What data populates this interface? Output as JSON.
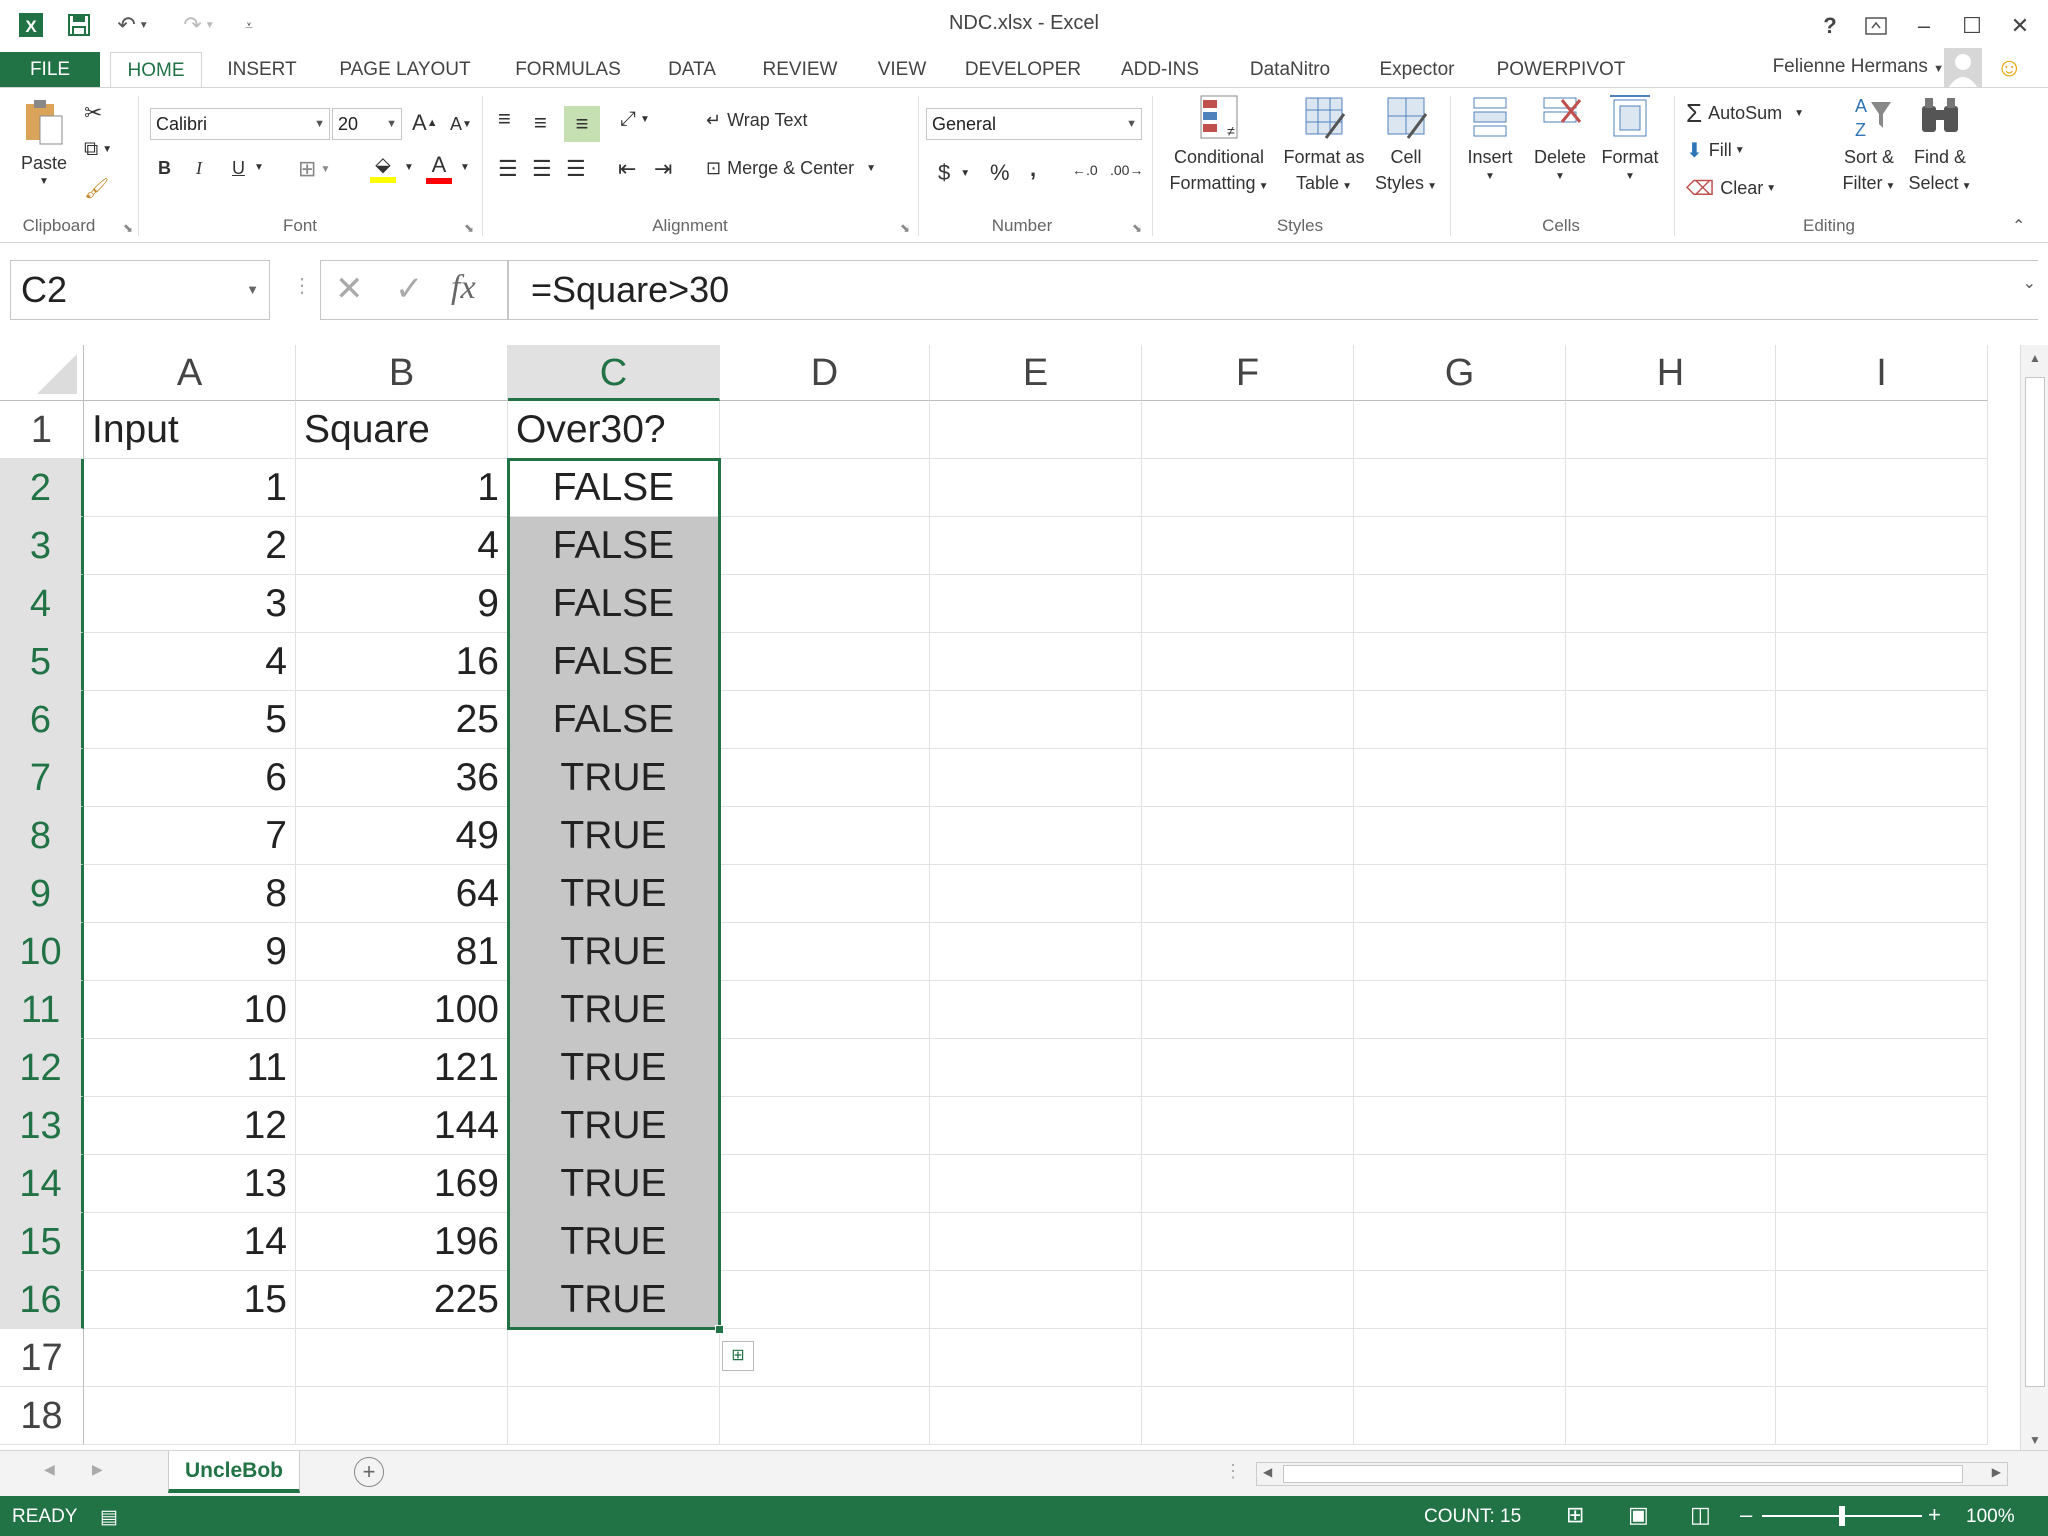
{
  "window": {
    "title": "NDC.xlsx - Excel",
    "help": "?",
    "user": "Felienne Hermans"
  },
  "ribbon_tabs": [
    "FILE",
    "HOME",
    "INSERT",
    "PAGE LAYOUT",
    "FORMULAS",
    "DATA",
    "REVIEW",
    "VIEW",
    "DEVELOPER",
    "ADD-INS",
    "DataNitro",
    "Expector",
    "POWERPIVOT"
  ],
  "ribbon": {
    "clipboard": {
      "paste": "Paste",
      "label": "Clipboard"
    },
    "font": {
      "name": "Calibri",
      "size": "20",
      "bold": "B",
      "italic": "I",
      "underline": "U",
      "label": "Font"
    },
    "alignment": {
      "wrap_text": "Wrap Text",
      "merge_center": "Merge & Center",
      "label": "Alignment"
    },
    "number": {
      "format": "General",
      "currency": "$",
      "percent": "%",
      "comma": ",",
      "label": "Number"
    },
    "styles": {
      "conditional_1": "Conditional",
      "conditional_2": "Formatting",
      "format_table_1": "Format as",
      "format_table_2": "Table",
      "cell_styles_1": "Cell",
      "cell_styles_2": "Styles",
      "label": "Styles"
    },
    "cells": {
      "insert": "Insert",
      "delete": "Delete",
      "format": "Format",
      "label": "Cells"
    },
    "editing": {
      "autosum": "AutoSum",
      "fill": "Fill",
      "clear": "Clear",
      "sort_1": "Sort &",
      "sort_2": "Filter",
      "find_1": "Find &",
      "find_2": "Select",
      "label": "Editing"
    }
  },
  "formula_bar": {
    "name_box": "C2",
    "fx": "fx",
    "formula": "=Square>30"
  },
  "sheet": {
    "columns": [
      "A",
      "B",
      "C",
      "D",
      "E",
      "F",
      "G",
      "H",
      "I"
    ],
    "selected_column": "C",
    "selected_rows": [
      2,
      16
    ],
    "rows": [
      {
        "n": "1",
        "a": "Input",
        "b": "Square",
        "c": "Over30?"
      },
      {
        "n": "2",
        "a": "1",
        "b": "1",
        "c": "FALSE"
      },
      {
        "n": "3",
        "a": "2",
        "b": "4",
        "c": "FALSE"
      },
      {
        "n": "4",
        "a": "3",
        "b": "9",
        "c": "FALSE"
      },
      {
        "n": "5",
        "a": "4",
        "b": "16",
        "c": "FALSE"
      },
      {
        "n": "6",
        "a": "5",
        "b": "25",
        "c": "FALSE"
      },
      {
        "n": "7",
        "a": "6",
        "b": "36",
        "c": "TRUE"
      },
      {
        "n": "8",
        "a": "7",
        "b": "49",
        "c": "TRUE"
      },
      {
        "n": "9",
        "a": "8",
        "b": "64",
        "c": "TRUE"
      },
      {
        "n": "10",
        "a": "9",
        "b": "81",
        "c": "TRUE"
      },
      {
        "n": "11",
        "a": "10",
        "b": "100",
        "c": "TRUE"
      },
      {
        "n": "12",
        "a": "11",
        "b": "121",
        "c": "TRUE"
      },
      {
        "n": "13",
        "a": "12",
        "b": "144",
        "c": "TRUE"
      },
      {
        "n": "14",
        "a": "13",
        "b": "169",
        "c": "TRUE"
      },
      {
        "n": "15",
        "a": "14",
        "b": "196",
        "c": "TRUE"
      },
      {
        "n": "16",
        "a": "15",
        "b": "225",
        "c": "TRUE"
      },
      {
        "n": "17",
        "a": "",
        "b": "",
        "c": ""
      },
      {
        "n": "18",
        "a": "",
        "b": "",
        "c": ""
      }
    ],
    "active_sheet": "UncleBob"
  },
  "status_bar": {
    "mode": "READY",
    "count": "COUNT: 15",
    "zoom_percent": "100%",
    "zoom_level": 100
  },
  "colors": {
    "excel_green": "#217346",
    "selection_fill": "#c6c6c6",
    "header_selected": "#e1e1e1"
  }
}
